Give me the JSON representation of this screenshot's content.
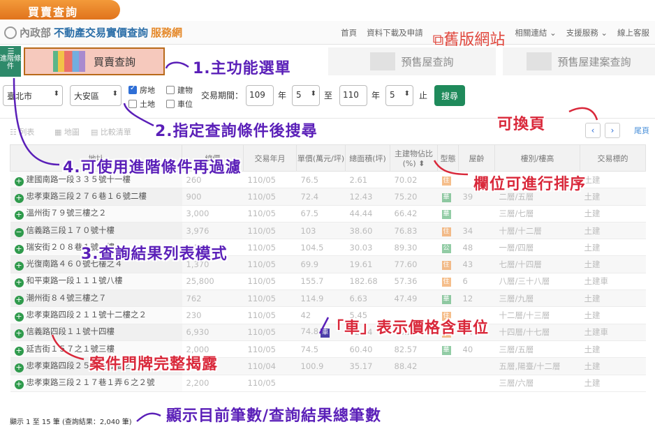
{
  "ribbon": "買賣查詢",
  "site": {
    "logo_left": "內政部",
    "logo_mid": "不動產交易實價查詢",
    "logo_right": "服務網"
  },
  "nav": [
    "首頁",
    "資料下載及申請",
    "舊版網站",
    "相關連結",
    "支援服務",
    "線上客服"
  ],
  "advanced_button": "進階條件",
  "tabs": {
    "main": "買賣查詢",
    "presale": "預售屋查詢",
    "presale_project": "預售屋建案查詢"
  },
  "search": {
    "city": "臺北市",
    "district": "大安區",
    "types": [
      {
        "label": "房地",
        "checked": true
      },
      {
        "label": "建物",
        "checked": false
      },
      {
        "label": "土地",
        "checked": false
      },
      {
        "label": "車位",
        "checked": false
      }
    ],
    "period_label": "交易期間：",
    "from_year": "109",
    "year_unit": "年",
    "from_month": "5",
    "to_label": "至",
    "to_year": "110",
    "to_month": "5",
    "end_label": "止",
    "search_button": "搜尋"
  },
  "toolbar": {
    "list": "列表",
    "map": "地圖",
    "compare": "比較清單",
    "last_page": "尾頁"
  },
  "table": {
    "headers": [
      "地址",
      "總價",
      "交易年月",
      "單價(萬元/坪)",
      "總面積(坪)",
      "主建物佔比(%)",
      "型態",
      "屋齡",
      "樓別/樓高",
      "交易標的"
    ],
    "rows": [
      [
        "建國南路一段３３５號十一樓",
        "260",
        "110/05",
        "76.5",
        "2.61",
        "70.02",
        "住",
        "",
        "",
        "土建"
      ],
      [
        "忠孝東路三段２７６巷１６號二樓",
        "900",
        "110/05",
        "72.4",
        "12.43",
        "75.20",
        "華",
        "39",
        "二層/五層",
        "土建"
      ],
      [
        "溫州街７９號三樓之２",
        "3,000",
        "110/05",
        "67.5",
        "44.44",
        "66.42",
        "華",
        "",
        "三層/七層",
        "土建"
      ],
      [
        "信義路三段１７０號十樓",
        "3,976",
        "110/05",
        "103",
        "38.60",
        "76.83",
        "住",
        "34",
        "十層/十二層",
        "土建"
      ],
      [
        "瑞安街２０８巷１號一樓",
        "3,130",
        "110/05",
        "104.5",
        "30.03",
        "89.30",
        "公",
        "48",
        "一層/四層",
        "土建"
      ],
      [
        "光復南路４６０號七樓之４",
        "1,370",
        "110/05",
        "69.9",
        "19.61",
        "77.60",
        "住",
        "43",
        "七層/十四層",
        "土建"
      ],
      [
        "和平東路一段１１１號八樓",
        "25,800",
        "110/05",
        "155.7",
        "182.68",
        "57.36",
        "住",
        "6",
        "八層/三十八層",
        "土建車"
      ],
      [
        "潮州街８４號三樓之７",
        "762",
        "110/05",
        "114.9",
        "6.63",
        "47.49",
        "華",
        "12",
        "三層/九層",
        "土建"
      ],
      [
        "忠孝東路四段２１１號十二樓之２",
        "230",
        "110/05",
        "42",
        "5.45",
        "",
        "住",
        "",
        "十二層/十三層",
        "土建"
      ],
      [
        "信義路四段１１號十四樓",
        "6,930",
        "110/05",
        "74.8",
        "92.64",
        "76.28",
        "住",
        "34",
        "十四層/十七層",
        "土建車"
      ],
      [
        "延吉街１５７之１號三樓",
        "2,000",
        "110/05",
        "74.5",
        "60.40",
        "82.57",
        "華",
        "40",
        "三層/五層",
        "土建"
      ],
      [
        "忠孝東路四段２５０號五樓之１",
        "3,550",
        "110/04",
        "100.9",
        "35.17",
        "88.42",
        "",
        "",
        "五層,陽臺/十二層",
        "土建"
      ],
      [
        "忠孝東路三段２１７巷１弄６之２號",
        "2,200",
        "110/05",
        "",
        "",
        "",
        "",
        "",
        "三層/六層",
        "土建"
      ]
    ]
  },
  "footer": "顯示 1 至 15 筆 (查詢結果：2,040 筆)",
  "annotations": {
    "a1": "1.主功能選單",
    "a2": "2.指定查詢條件後搜尋",
    "a3": "3.查詢結果列表模式",
    "a4": "4.可使用進階條件再過濾",
    "a5": "可換頁",
    "a6": "欄位可進行排序",
    "a7": "「車」表示價格含車位",
    "a8": "案件門牌完整揭露",
    "a9": "顯示目前筆數/查詢結果總筆數"
  },
  "colors": {
    "accent": "#5a1fb8",
    "alert": "#d9283a",
    "brand_green": "#1f8a5b",
    "ribbon": "#e0731c"
  }
}
